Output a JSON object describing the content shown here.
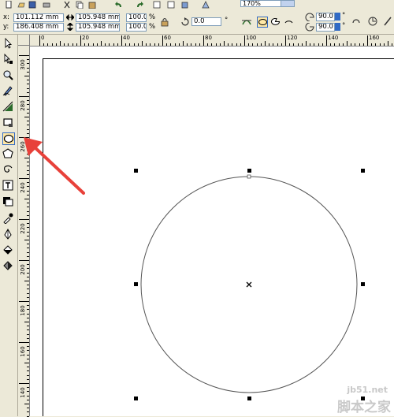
{
  "property_bar": {
    "x_label": "x:",
    "x_value": "101.112 mm",
    "y_label": "y:",
    "y_value": "186.408 mm",
    "width_value": "105.948 mm",
    "height_value": "105.948 mm",
    "scale_x": "100.0",
    "scale_y": "100.0",
    "scale_unit": "%",
    "rotation_value": "0.0",
    "rotation_unit": "°",
    "zoom_value": "170%",
    "start_angle": "90.0",
    "end_angle": "90.0",
    "angle_unit": "°"
  },
  "rulers": {
    "horizontal": [
      "0",
      "20",
      "40",
      "60",
      "80",
      "100",
      "120",
      "140",
      "160"
    ],
    "vertical": [
      "300",
      "280",
      "260",
      "240",
      "220",
      "200",
      "180",
      "160",
      "140"
    ]
  },
  "toolbox": {
    "tools": [
      "pick-tool",
      "shape-tool",
      "zoom-tool",
      "freehand-tool",
      "smart-fill-tool",
      "rectangle-tool",
      "ellipse-tool",
      "polygon-tool",
      "spiral-tool",
      "text-tool",
      "interactive-tool",
      "eyedropper-tool",
      "outline-tool",
      "fill-tool",
      "interactive-fill-tool"
    ],
    "active_tool": "ellipse-tool"
  },
  "colors": {
    "annotation_arrow": "#e8413a",
    "selection_accent": "#316ac5"
  },
  "watermark": {
    "site": "jb51.net",
    "text": "脚本之家"
  }
}
